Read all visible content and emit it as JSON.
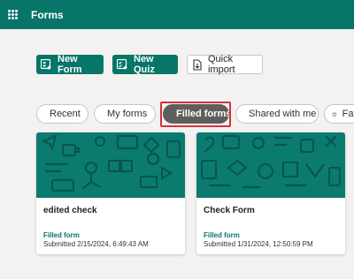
{
  "app": {
    "title": "Forms"
  },
  "actions": {
    "new_form": "New Form",
    "new_quiz": "New Quiz",
    "quick_import": "Quick import"
  },
  "filters": [
    {
      "label": "Recent",
      "icon": "clock-icon"
    },
    {
      "label": "My forms",
      "icon": "document-icon"
    },
    {
      "label": "Filled forms",
      "icon": "bookmark-icon",
      "selected": true
    },
    {
      "label": "Shared with me",
      "icon": "people-icon"
    },
    {
      "label": "Fav",
      "icon": "star-icon"
    }
  ],
  "cards": [
    {
      "title": "edited check",
      "status": "Filled form",
      "submitted": "Submitted 2/15/2024, 6:49:43 AM"
    },
    {
      "title": "Check Form",
      "status": "Filled form",
      "submitted": "Submitted 1/31/2024, 12:50:59 PM"
    }
  ],
  "colors": {
    "brand": "#077568",
    "selected_pill": "#605e5c",
    "highlight": "#d13438"
  }
}
